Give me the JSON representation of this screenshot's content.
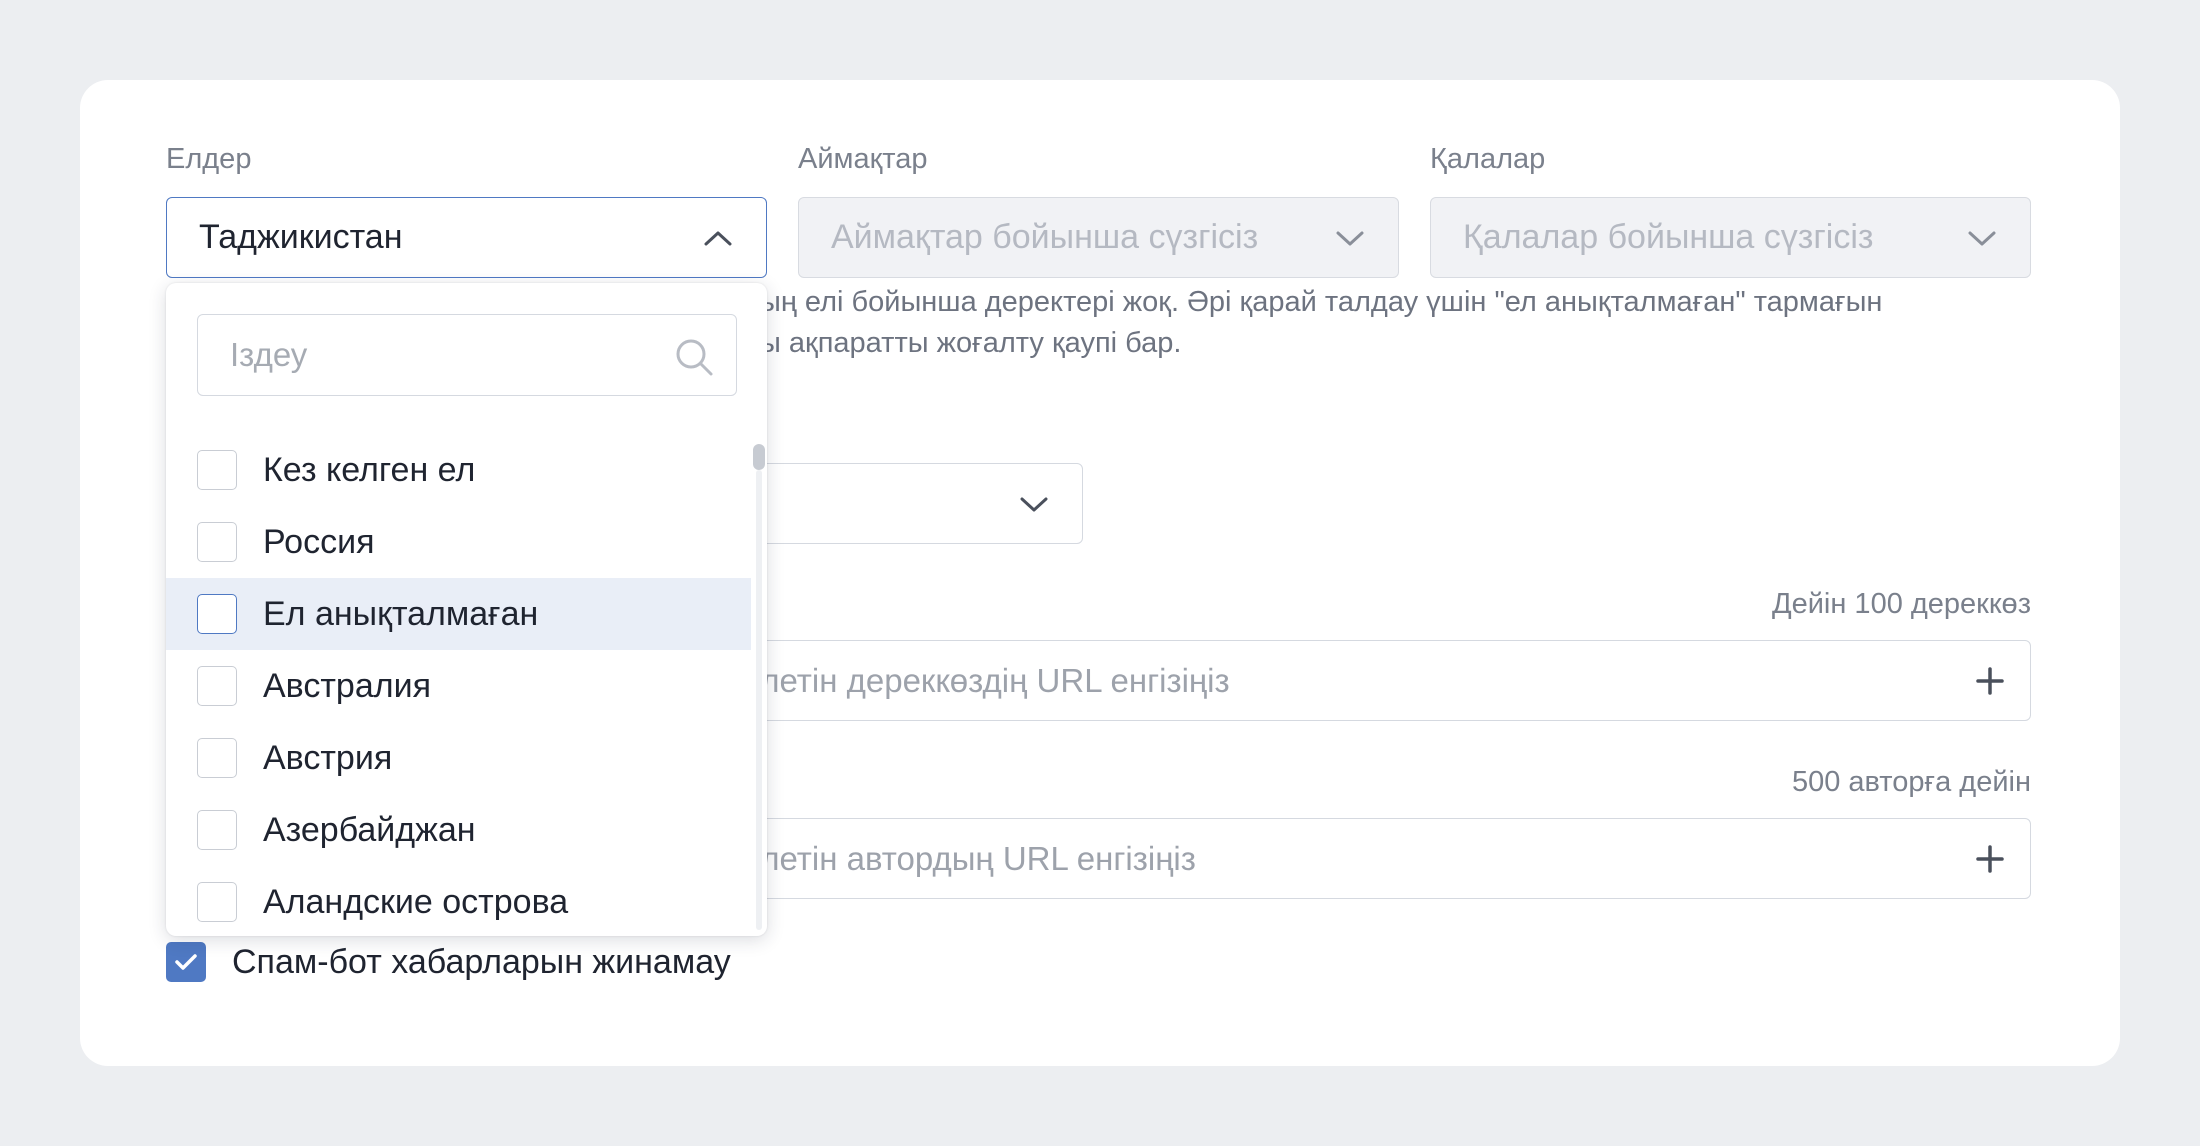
{
  "filters": {
    "countries": {
      "label": "Елдер",
      "value": "Таджикистан"
    },
    "regions": {
      "label": "Аймақтар",
      "placeholder": "Аймақтар бойынша сүзгісіз"
    },
    "cities": {
      "label": "Қалалар",
      "placeholder": "Қалалар бойынша сүзгісіз"
    }
  },
  "helper": {
    "line1": "ың елі бойынша деректері жоқ. Әрі қарай талдау үшін \"ел анықталмаған\" тармағын",
    "line2": "ы ақпаратты жоғалту қаупі бар."
  },
  "sources": {
    "limit": "Дейін 100 дереккөз",
    "placeholder": "елетін дереккөздің URL енгізіңіз"
  },
  "authors": {
    "limit": "500 авторға дейін",
    "placeholder": "елетін автордың URL енгізіңіз"
  },
  "spam": {
    "label": "Спам-бот хабарларын жинамау",
    "checked": true
  },
  "dropdown": {
    "search_placeholder": "Іздеу",
    "options": [
      {
        "label": "Кез келген ел",
        "checked": false
      },
      {
        "label": "Россия",
        "checked": false
      },
      {
        "label": "Ел анықталмаған",
        "checked": false,
        "highlighted": true
      },
      {
        "label": "Австралия",
        "checked": false
      },
      {
        "label": "Австрия",
        "checked": false
      },
      {
        "label": "Азербайджан",
        "checked": false
      },
      {
        "label": "Аландские острова",
        "checked": false
      }
    ]
  },
  "colors": {
    "accent": "#4f79c3",
    "hover": "#e9eef7"
  }
}
